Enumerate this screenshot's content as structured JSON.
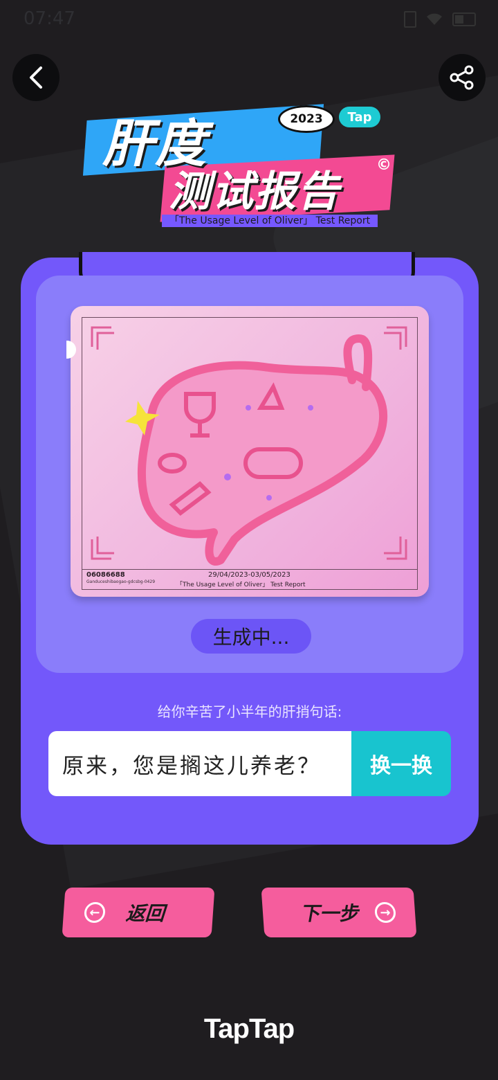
{
  "status_bar": {
    "time": "07:47"
  },
  "title": {
    "main": "肝度",
    "sub": "测试报告",
    "year": "2023",
    "brand_tag": "Tap",
    "copyright": "©",
    "caption": "「The Usage Level of Oliver」 Test Report"
  },
  "ticket": {
    "id": "06086688",
    "code": "Ganduceshibaogao-gdcsbg-0429",
    "date_range": "29/04/2023-03/05/2023",
    "caption": "「The Usage Level of Oliver」 Test Report"
  },
  "generating_label": "生成中...",
  "prompt": "给你辛苦了小半年的肝捎句话:",
  "quote": {
    "text": "原来，您是搁这儿养老？",
    "refresh_label": "换一换"
  },
  "buttons": {
    "back": "返回",
    "next": "下一步"
  },
  "footer_brand": "TapTap",
  "colors": {
    "background": "#1f1d20",
    "card": "#7358fa",
    "accent_pink": "#f55d9d",
    "accent_cyan": "#18c4cf",
    "title_blue": "#2fa6f7"
  }
}
